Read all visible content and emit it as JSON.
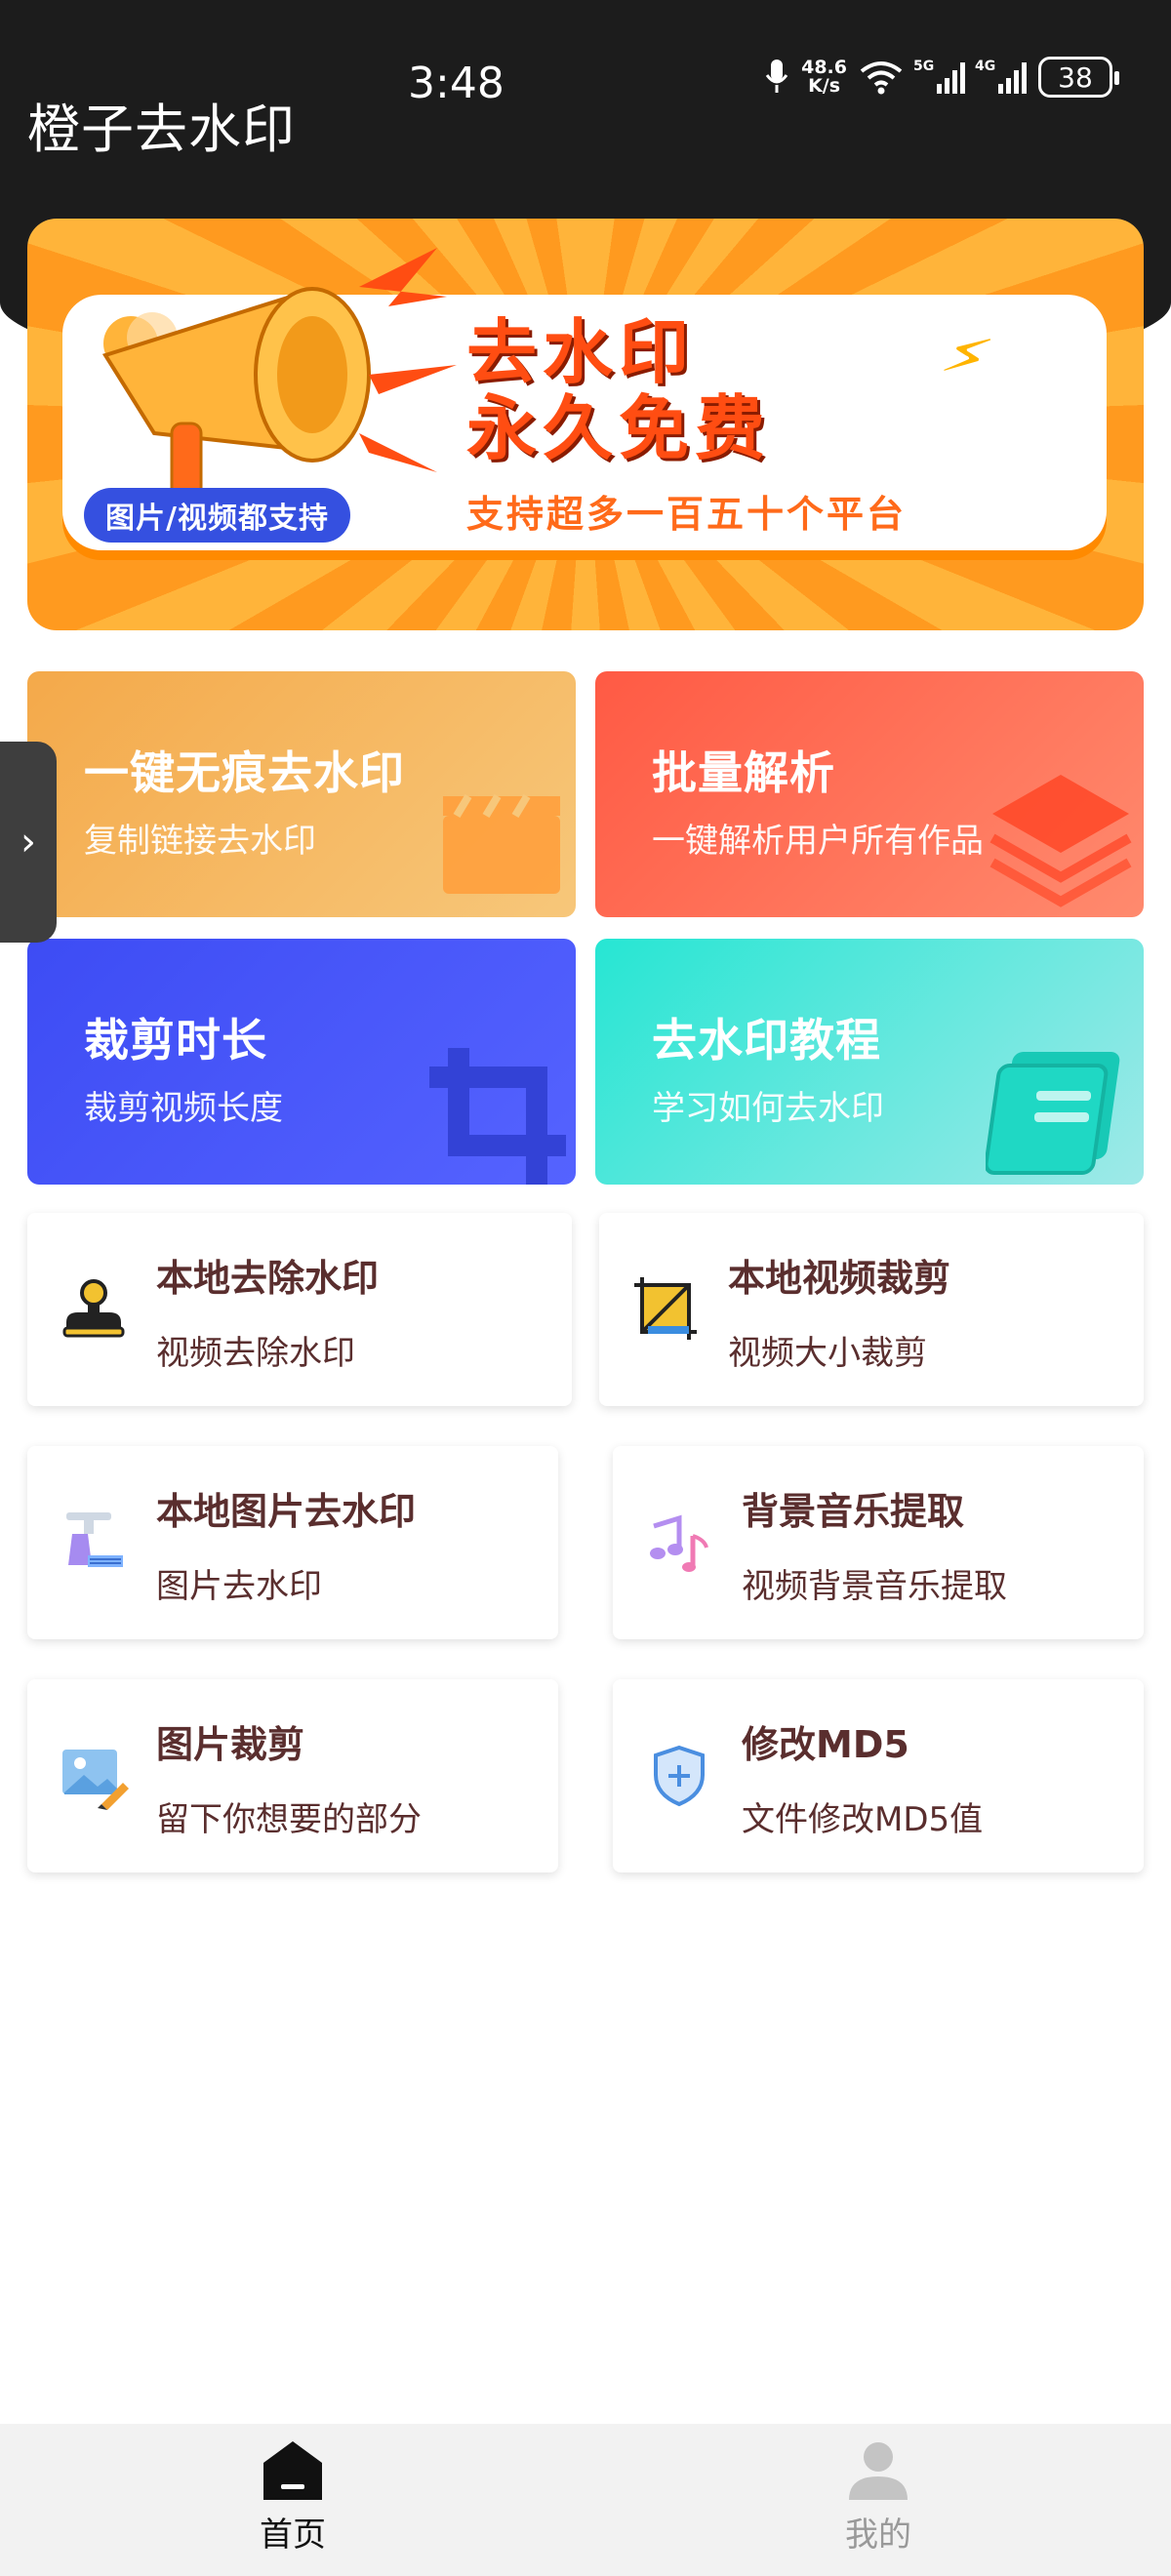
{
  "status_bar": {
    "time": "3:48",
    "net_speed_value": "48.6",
    "net_speed_unit": "K/s",
    "sim1_label": "5G",
    "sim2_label": "4G",
    "battery": "38"
  },
  "app": {
    "title": "橙子去水印"
  },
  "banner": {
    "headline_1": "去水印",
    "headline_2": "永久免费",
    "tag": "图片/视频都支持",
    "subline": "支持超多一百五十个平台"
  },
  "feature_cards": [
    {
      "title": "一键无痕去水印",
      "subtitle": "复制链接去水印",
      "icon": "clapperboard-icon",
      "color": "#f4a94a"
    },
    {
      "title": "批量解析",
      "subtitle": "一键解析用户所有作品",
      "icon": "layers-icon",
      "color": "#ff5a44"
    },
    {
      "title": "裁剪时长",
      "subtitle": "裁剪视频长度",
      "icon": "crop-icon",
      "color": "#3d4cf4"
    },
    {
      "title": "去水印教程",
      "subtitle": "学习如何去水印",
      "icon": "book-icon",
      "color": "#26e6d3"
    }
  ],
  "tools": [
    {
      "title": "本地去除水印",
      "subtitle": "视频去除水印",
      "icon": "stamp-icon"
    },
    {
      "title": "本地视频裁剪",
      "subtitle": "视频大小裁剪",
      "icon": "crop-frame-icon"
    },
    {
      "title": "本地图片去水印",
      "subtitle": "图片去水印",
      "icon": "faucet-icon"
    },
    {
      "title": "背景音乐提取",
      "subtitle": "视频背景音乐提取",
      "icon": "music-notes-icon"
    },
    {
      "title": "图片裁剪",
      "subtitle": "留下你想要的部分",
      "icon": "picture-edit-icon"
    },
    {
      "title": "修改MD5",
      "subtitle": "文件修改MD5值",
      "icon": "shield-plus-icon"
    }
  ],
  "bottom_nav": [
    {
      "label": "首页",
      "icon": "home-icon",
      "active": true
    },
    {
      "label": "我的",
      "icon": "user-icon",
      "active": false
    }
  ]
}
